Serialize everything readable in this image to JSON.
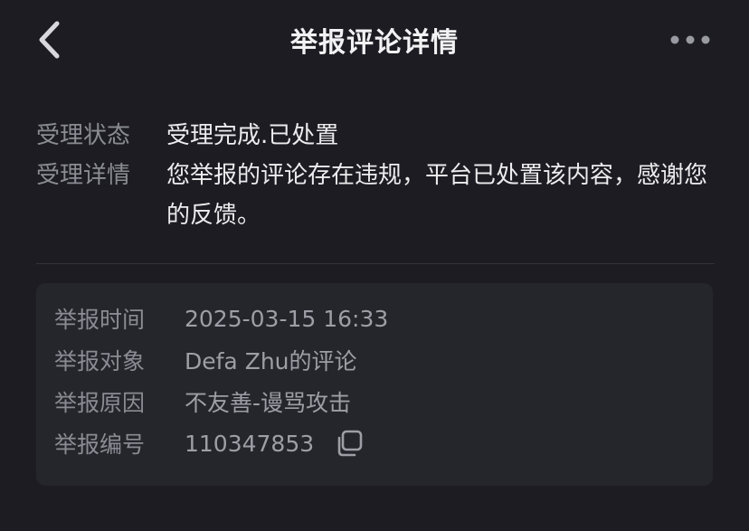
{
  "header": {
    "title": "举报评论详情"
  },
  "status": {
    "state_label": "受理状态",
    "state_value": "受理完成.已处置",
    "detail_label": "受理详情",
    "detail_value": "您举报的评论存在违规，平台已处置该内容，感谢您的反馈。"
  },
  "report": {
    "time_label": "举报时间",
    "time_value": "2025-03-15 16:33",
    "target_label": "举报对象",
    "target_value": "Defa Zhu的评论",
    "reason_label": "举报原因",
    "reason_value": "不友善-谩骂攻击",
    "number_label": "举报编号",
    "number_value": "110347853"
  },
  "icons": {
    "back": "chevron-left-icon",
    "more": "more-horizontal-icon",
    "copy": "copy-icon"
  },
  "colors": {
    "background": "#1c1c22",
    "card": "#25252c",
    "label": "#8b8b93",
    "value": "#ececee"
  }
}
